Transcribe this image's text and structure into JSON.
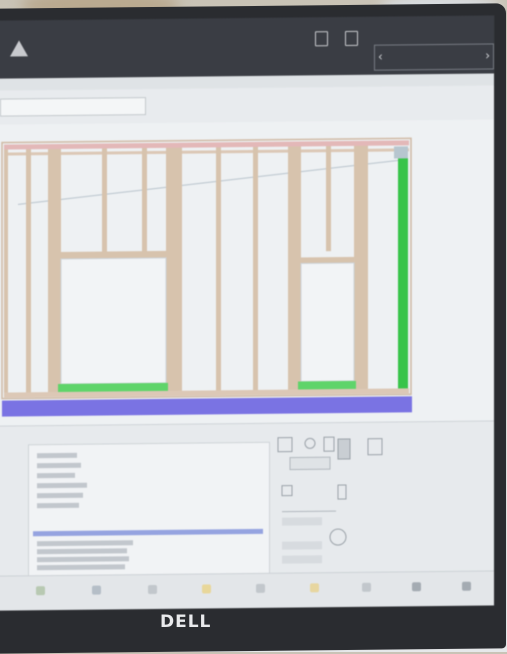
{
  "monitor": {
    "brand": "DELL"
  },
  "app": {
    "title": "",
    "subtitle": ""
  },
  "colors": {
    "stud": "#d7c3ad",
    "plate_bottom": "#5fd46a",
    "end_stud": "#38c449",
    "foundation": "#7a73e3",
    "selection": "#7e8edb"
  },
  "icons": [
    "app-logo-icon",
    "document-icon",
    "export-icon",
    "chevron-left-icon",
    "chevron-right-icon"
  ]
}
